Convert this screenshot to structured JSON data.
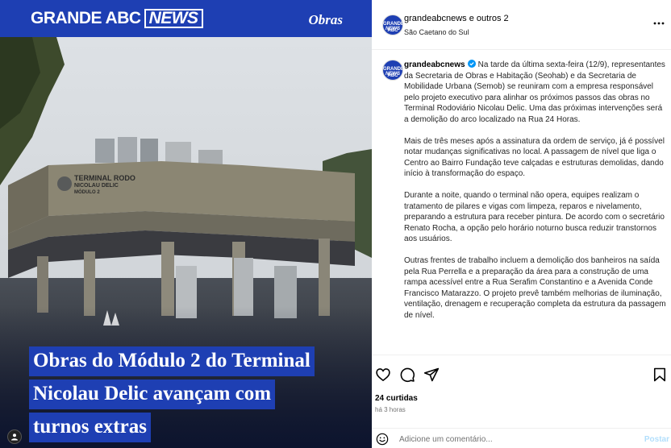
{
  "media": {
    "brand_main": "GRANDE ABC",
    "brand_news": "NEWS",
    "section": "Obras",
    "headline_lines": [
      "Obras do Módulo 2 do Terminal",
      "Nicolau Delic avançam com",
      "turnos extras"
    ],
    "sign_text": [
      "TERMINAL RODO",
      "NICOLAU DELIC",
      "MÓDULO 2"
    ],
    "brand_color": "#1e3fb3"
  },
  "header": {
    "username": "grandeabcnews e outros 2",
    "location": "São Caetano do Sul",
    "more_icon": "more-horizontal-icon"
  },
  "caption": {
    "username": "grandeabcnews",
    "verified_icon": "verified-badge-icon",
    "paragraphs": [
      "Na tarde da última sexta-feira (12/9), representantes da Secretaria de Obras e Habitação (Seohab) e da Secretaria de Mobilidade Urbana (Semob) se reuniram com a empresa responsável pelo projeto executivo para alinhar os próximos passos das obras no Terminal Rodoviário Nicolau Delic. Uma das próximas intervenções será a demolição do arco localizado na Rua 24 Horas.",
      "Mais de três meses após a assinatura da ordem de serviço, já é possível notar mudanças significativas no local. A passagem de nível que liga o Centro ao Bairro Fundação teve calçadas e estruturas demolidas, dando início à transformação do espaço.",
      "Durante a noite, quando o terminal não opera, equipes realizam o tratamento de pilares e vigas com limpeza, reparos e nivelamento, preparando a estrutura para receber pintura. De acordo com o secretário Renato Rocha, a opção pelo horário noturno busca reduzir transtornos aos usuários.",
      "Outras frentes de trabalho incluem a demolição dos banheiros na saída pela Rua Perrella e a preparação da área para a construção de uma rampa acessível entre a Rua Serafim Constantino e a Avenida Conde Francisco Matarazzo. O projeto prevê também melhorias de iluminação, ventilação, drenagem e recuperação completa da estrutura da passagem de nível."
    ]
  },
  "actions": {
    "icons": [
      "heart-icon",
      "comment-icon",
      "share-icon",
      "bookmark-icon"
    ],
    "likes": "24 curtidas",
    "time": "há 3 horas"
  },
  "comment": {
    "placeholder": "Adicione um comentário...",
    "post_label": "Postar",
    "emoji_icon": "emoji-icon"
  },
  "avatar": {
    "line1": "GRANDE ABC",
    "line2": "NEWS"
  }
}
